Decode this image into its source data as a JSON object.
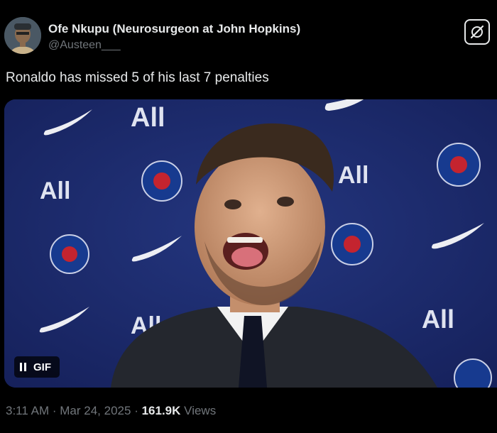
{
  "author": {
    "display_name": "Ofe Nkupu (Neurosurgeon at John Hopkins)",
    "handle": "@Austeen___"
  },
  "tweet": {
    "text": "Ronaldo has missed 5 of his last 7 penalties"
  },
  "media": {
    "type": "gif",
    "badge_label": "GIF",
    "backdrop_text": "All",
    "backdrop_color": "#1c2a6b"
  },
  "meta": {
    "time": "3:11 AM",
    "separator": "·",
    "date": "Mar 24, 2025",
    "views_count": "161.9K",
    "views_label": "Views"
  },
  "icons": {
    "grok": "grok-icon",
    "pause": "pause-icon"
  },
  "colors": {
    "background": "#000000",
    "text_primary": "#e7e9ea",
    "text_secondary": "#71767b"
  }
}
